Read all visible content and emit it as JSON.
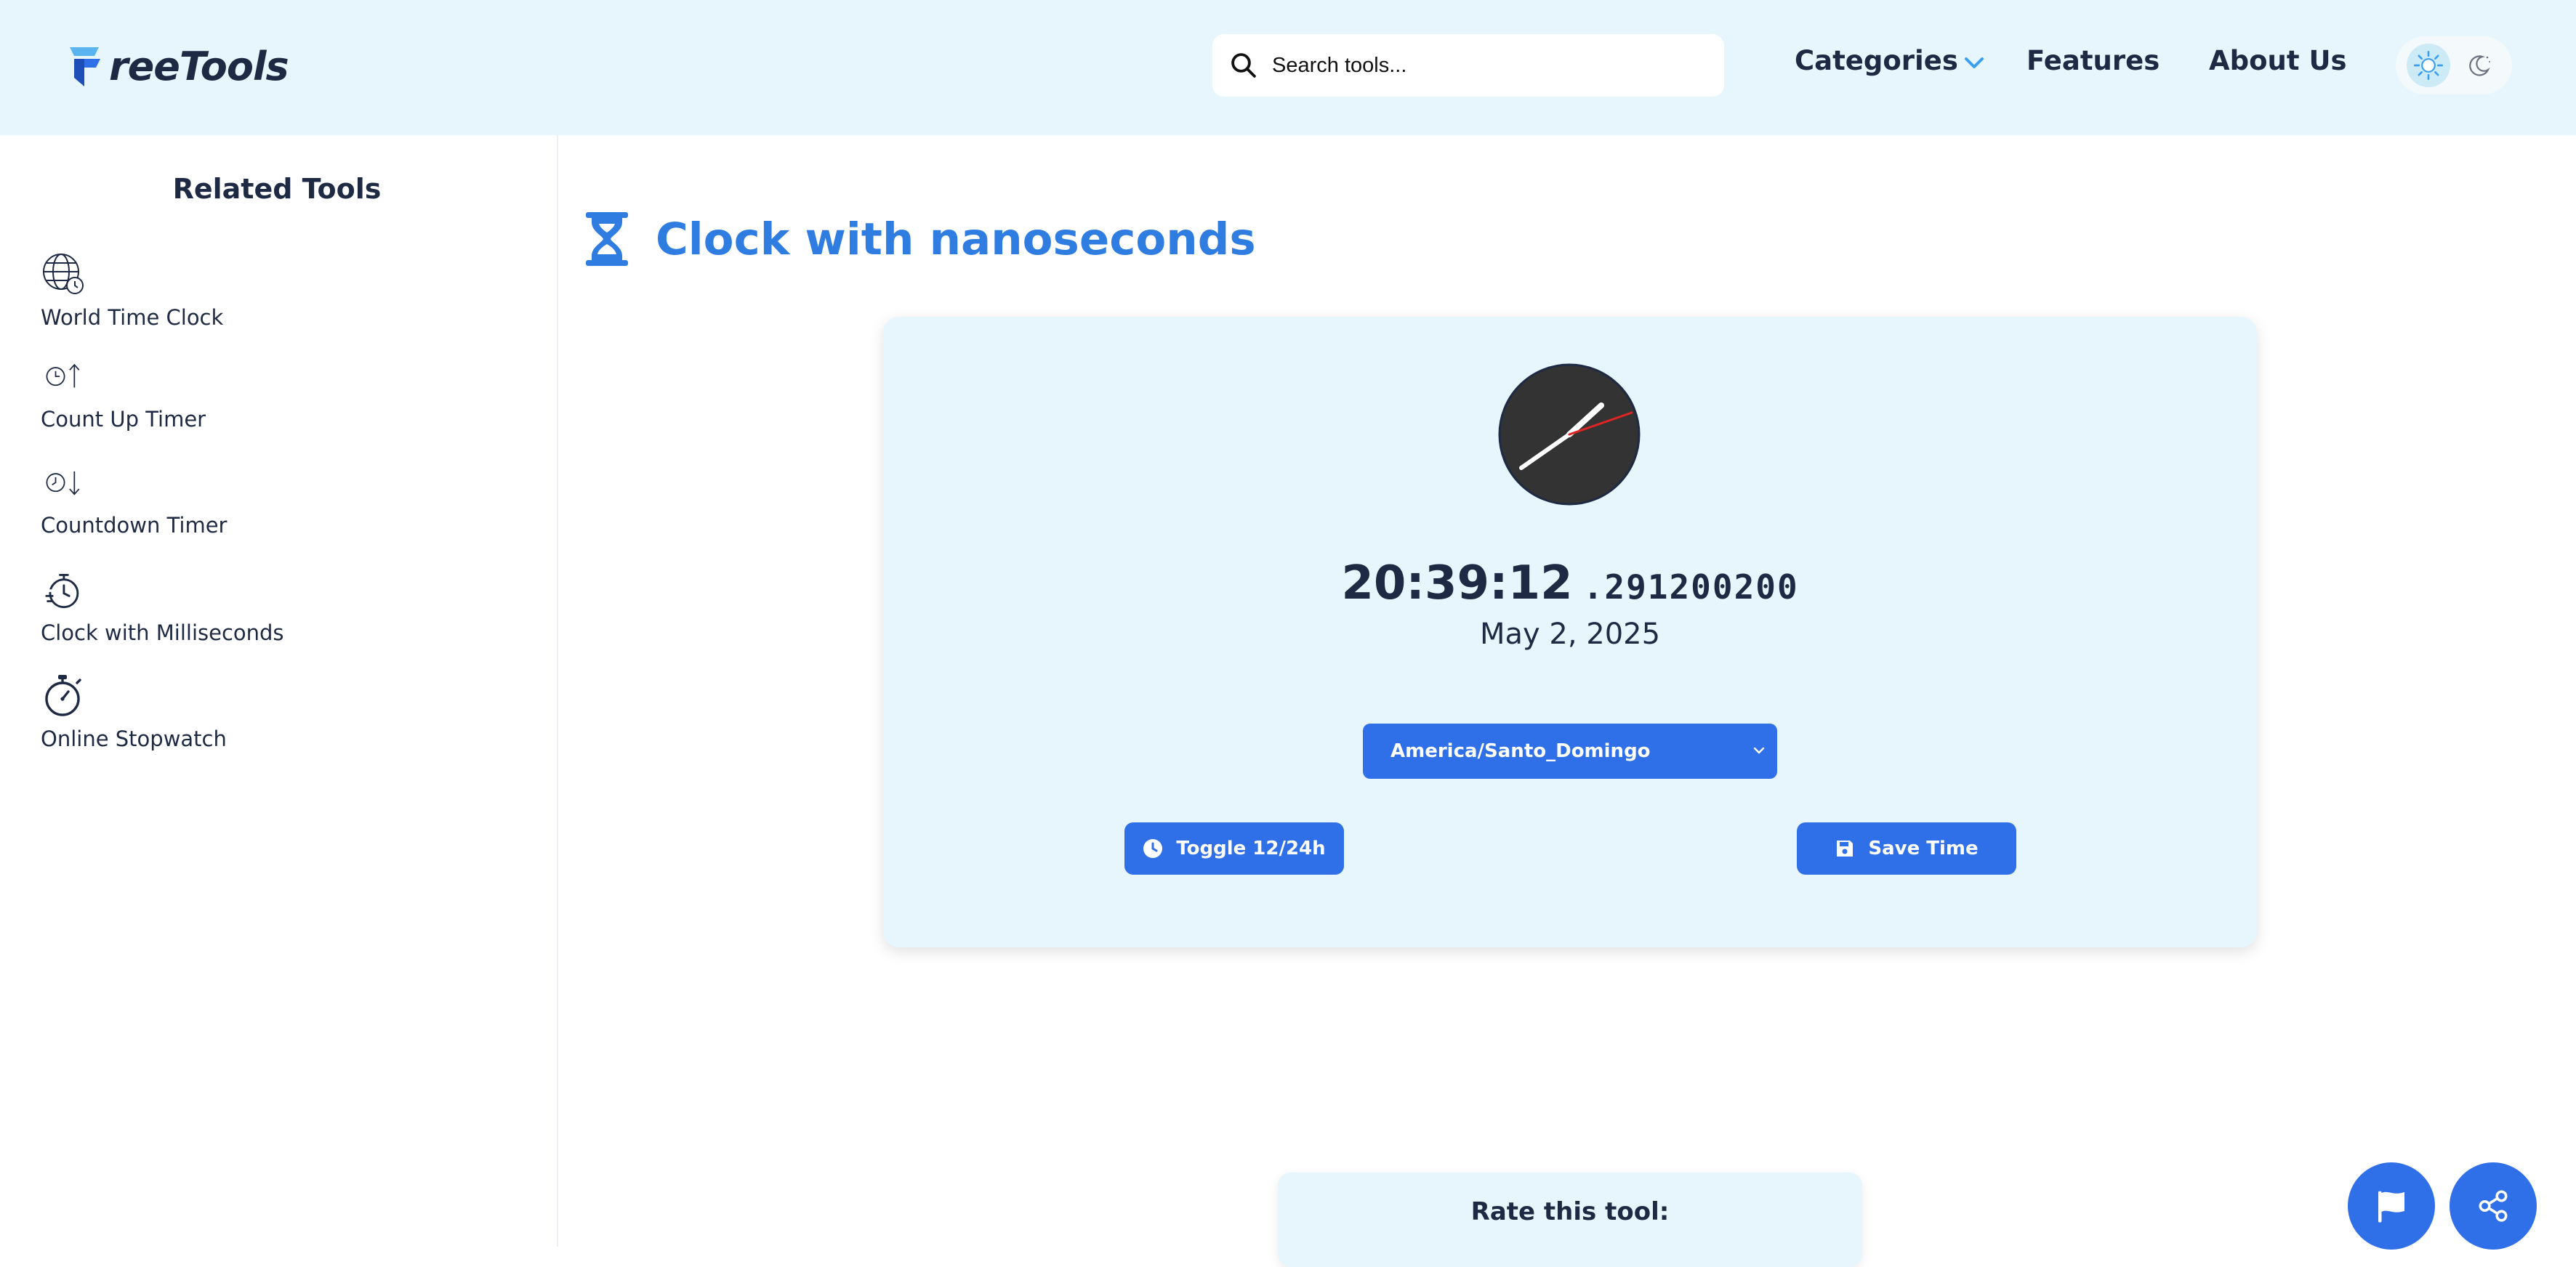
{
  "header": {
    "logo_text": "reeTools",
    "search_placeholder": "Search tools...",
    "nav": {
      "categories": "Categories",
      "features": "Features",
      "about": "About Us"
    }
  },
  "sidebar": {
    "title": "Related Tools",
    "items": [
      {
        "label": "World Time Clock",
        "icon": "globe-clock-icon"
      },
      {
        "label": "Count Up Timer",
        "icon": "clock-up-icon"
      },
      {
        "label": "Countdown Timer",
        "icon": "clock-down-icon"
      },
      {
        "label": "Clock with Milliseconds",
        "icon": "timer-lines-icon"
      },
      {
        "label": "Online Stopwatch",
        "icon": "stopwatch-icon"
      }
    ]
  },
  "main": {
    "title": "Clock with nanoseconds",
    "time": "20:39:12",
    "nanoseconds": ".291200200",
    "date": "May 2, 2025",
    "timezone": "America/Santo_Domingo",
    "toggle_label": "Toggle 12/24h",
    "save_label": "Save Time",
    "rate_title": "Rate this tool:"
  },
  "colors": {
    "accent": "#2f6fe8",
    "title": "#2f7de1",
    "header_bg": "#e6f6fc",
    "dark_text": "#1e2a44"
  }
}
